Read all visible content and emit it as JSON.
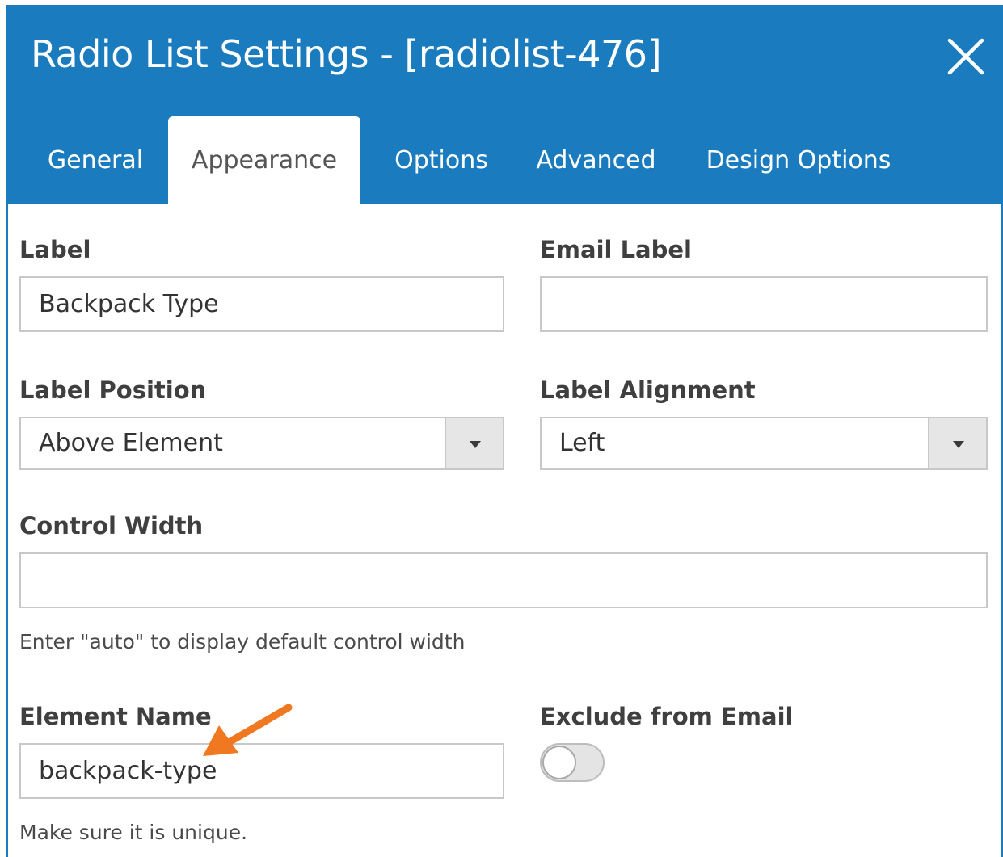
{
  "dialog": {
    "title": "Radio List Settings - [radiolist-476]"
  },
  "tabs": [
    {
      "label": "General",
      "active": false
    },
    {
      "label": "Appearance",
      "active": true
    },
    {
      "label": "Options",
      "active": false
    },
    {
      "label": "Advanced",
      "active": false
    },
    {
      "label": "Design Options",
      "active": false
    }
  ],
  "form": {
    "label": {
      "title": "Label",
      "value": "Backpack Type"
    },
    "email_label": {
      "title": "Email Label",
      "value": ""
    },
    "label_position": {
      "title": "Label Position",
      "value": "Above Element"
    },
    "label_alignment": {
      "title": "Label Alignment",
      "value": "Left"
    },
    "control_width": {
      "title": "Control Width",
      "value": "",
      "help": "Enter \"auto\" to display default control width"
    },
    "element_name": {
      "title": "Element Name",
      "value": "backpack-type",
      "help": "Make sure it is unique."
    },
    "exclude_from_email": {
      "title": "Exclude from Email",
      "checked": false
    }
  },
  "colors": {
    "header_bg": "#1a7bbf",
    "annotation_arrow": "#f07820"
  },
  "icons": {
    "close": "close-icon",
    "dropdown": "chevron-down-icon",
    "annotation": "arrow-annotation"
  }
}
